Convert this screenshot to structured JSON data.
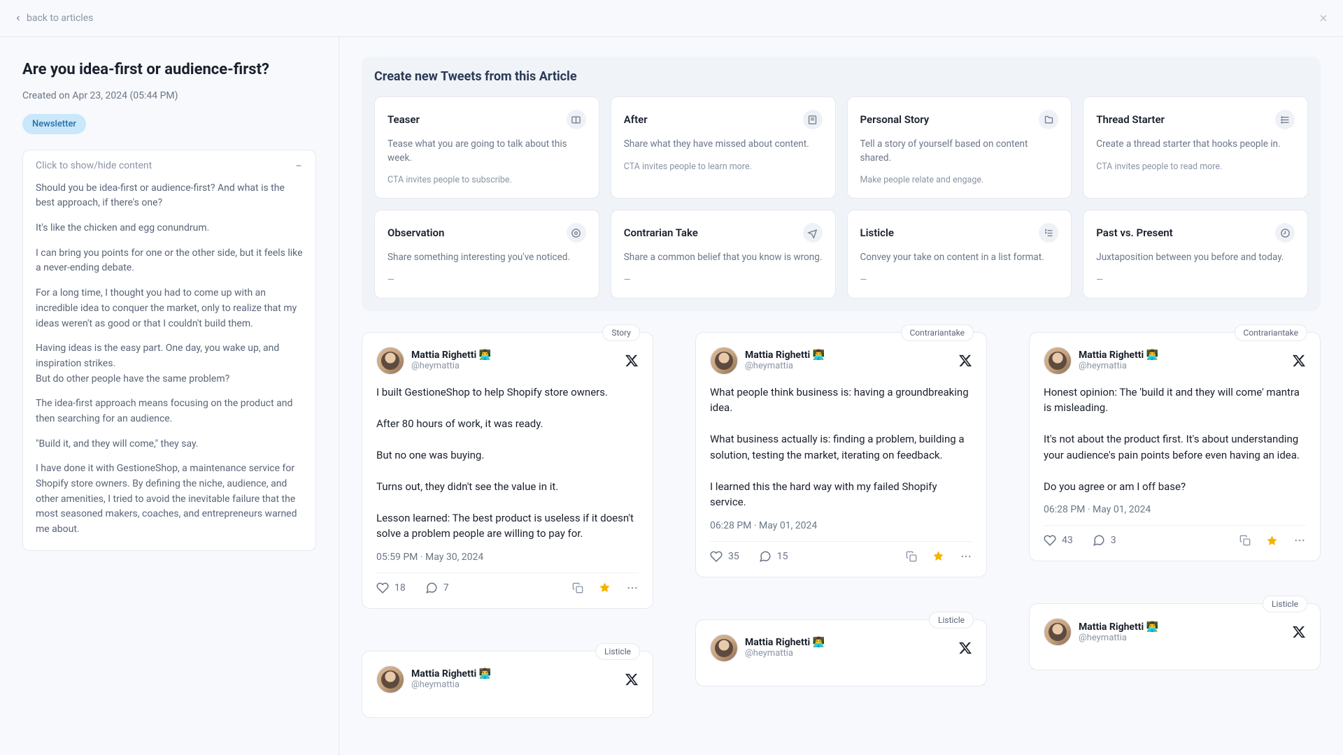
{
  "topbar": {
    "back": "back to articles"
  },
  "article": {
    "title": "Are you idea-first or audience-first?",
    "created": "Created on Apr 23, 2024 (05:44 PM)",
    "tag": "Newsletter",
    "toggle_label": "Click to show/hide content",
    "body": [
      "Should you be idea-first or audience-first? And what is the best approach, if there's one?",
      "It's like the chicken and egg conundrum.",
      "I can bring you points for one or the other side, but it feels like a never-ending debate.",
      "For a long time, I thought you had to come up with an incredible idea to conquer the market, only to realize that my ideas weren't as good or that I couldn't build them.",
      "Having ideas is the easy part. One day, you wake up, and inspiration strikes.\nBut do other people have the same problem?",
      "The idea-first approach means focusing on the product and then searching for an audience.",
      "\"Build it, and they will come,\" they say.",
      "I have done it with GestioneShop, a maintenance service for Shopify store owners. By defining the niche, audience, and other amenities, I tried to avoid the inevitable failure that the most seasoned makers, coaches, and entrepreneurs warned me about."
    ]
  },
  "templates_title": "Create new Tweets from this Article",
  "templates": [
    {
      "title": "Teaser",
      "desc": "Tease what you are going to talk about this week.",
      "cta": "CTA invites people to subscribe."
    },
    {
      "title": "After",
      "desc": "Share what they have missed about content.",
      "cta": "CTA invites people to learn more."
    },
    {
      "title": "Personal Story",
      "desc": "Tell a story of yourself based on content shared.",
      "cta": "Make people relate and engage."
    },
    {
      "title": "Thread Starter",
      "desc": "Create a thread starter that hooks people in.",
      "cta": "CTA invites people to read more."
    },
    {
      "title": "Observation",
      "desc": "Share something interesting you've noticed.",
      "cta": "—"
    },
    {
      "title": "Contrarian Take",
      "desc": "Share a common belief that you know is wrong.",
      "cta": "—"
    },
    {
      "title": "Listicle",
      "desc": "Convey your take on content in a list format.",
      "cta": "—"
    },
    {
      "title": "Past vs. Present",
      "desc": "Juxtaposition between you before and today.",
      "cta": "—"
    }
  ],
  "user": {
    "name": "Mattia Righetti 👨‍💻",
    "handle": "@heymattia"
  },
  "tweets": [
    {
      "label": "Story",
      "body": "I built GestioneShop to help Shopify store owners.\n\nAfter 80 hours of work, it was ready.\n\nBut no one was buying.\n\nTurns out, they didn't see the value in it.\n\nLesson learned: The best product is useless if it doesn't solve a problem people are willing to pay for.",
      "time": "05:59 PM · May 30, 2024",
      "likes": "18",
      "replies": "7"
    },
    {
      "label": "Contrariantake",
      "body": "What people think business is: having a groundbreaking idea.\n\nWhat business actually is: finding a problem, building a solution, testing the market, iterating on feedback.\n\nI learned this the hard way with my failed Shopify service.",
      "time": "06:28 PM · May 01, 2024",
      "likes": "35",
      "replies": "15"
    },
    {
      "label": "Contrariantake",
      "body": "Honest opinion: The 'build it and they will come' mantra is misleading.\n\nIt's not about the product first. It's about understanding your audience's pain points before even having an idea.\n\nDo you agree or am I off base?",
      "time": "06:28 PM · May 01, 2024",
      "likes": "43",
      "replies": "3"
    },
    {
      "label": "Listicle",
      "body": "",
      "time": "",
      "likes": "",
      "replies": ""
    },
    {
      "label": "Listicle",
      "body": "",
      "time": "",
      "likes": "",
      "replies": ""
    },
    {
      "label": "Listicle",
      "body": "",
      "time": "",
      "likes": "",
      "replies": ""
    }
  ]
}
